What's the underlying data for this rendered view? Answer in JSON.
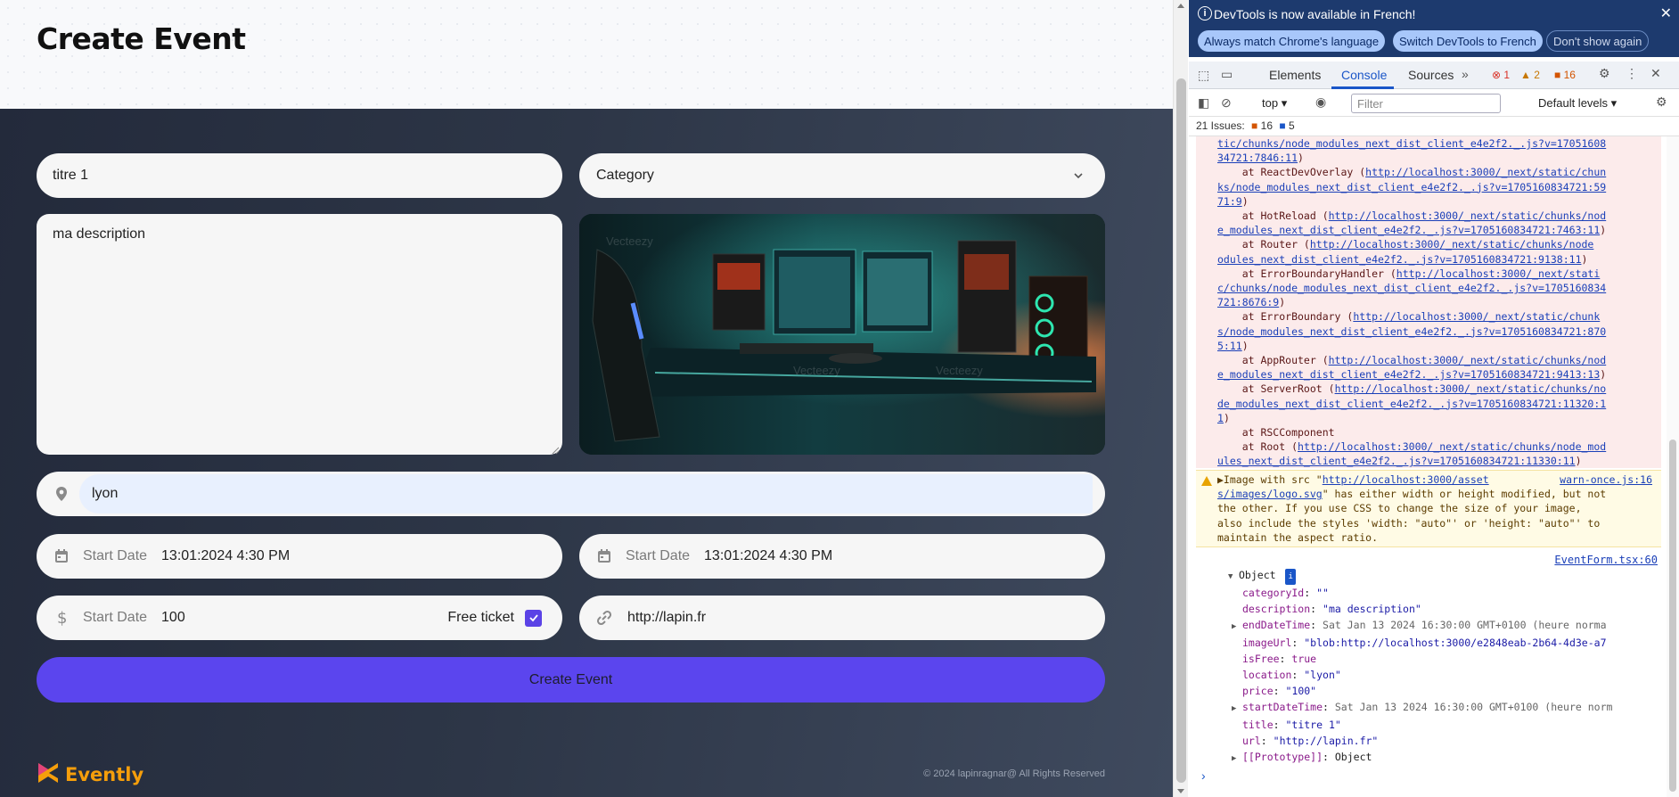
{
  "page": {
    "title": "Create Event"
  },
  "form": {
    "title_value": "titre 1",
    "category_placeholder": "Category",
    "description_value": "ma description",
    "location_value": "lyon",
    "start_date_1": {
      "label": "Start Date",
      "value": "13:01:2024 4:30 PM"
    },
    "start_date_2": {
      "label": "Start Date",
      "value": "13:01:2024 4:30 PM"
    },
    "price": {
      "label": "Start Date",
      "value": "100"
    },
    "free_ticket_label": "Free ticket",
    "free_ticket_checked": true,
    "url_value": "http://lapin.fr",
    "submit_label": "Create Event"
  },
  "footer": {
    "brand": "Evently",
    "copyright": "© 2024 lapinragnar@ All Rights Reserved"
  },
  "colors": {
    "accent": "#5b45ee",
    "brand_orange": "#f59e0b",
    "form_bg": "#2d3647"
  },
  "icons": {
    "location": "map-pin-icon",
    "calendar": "calendar-icon",
    "dollar": "dollar-icon",
    "link": "link-icon",
    "chevron": "chevron-down-icon"
  },
  "devtools": {
    "banner_text": "DevTools is now available in French!",
    "btn_match": "Always match Chrome's language",
    "btn_switch": "Switch DevTools to French",
    "btn_dont": "Don't show again",
    "tabs": [
      "Elements",
      "Console",
      "Sources"
    ],
    "error_count": "1",
    "warning_count": "2",
    "issue_count": "16",
    "context": "top",
    "filter_placeholder": "Filter",
    "levels": "Default levels",
    "issues_label": "21 Issues:",
    "issues_a": "16",
    "issues_b": "5",
    "stack_lines": [
      {
        "pre": "",
        "link": "tic/chunks/node_modules_next_dist_client_e4e2f2._.js?v=17051608",
        "post": ""
      },
      {
        "pre": "",
        "link": "34721:7846:11",
        "post": ")"
      },
      {
        "pre": "    at ReactDevOverlay (",
        "link": "http://localhost:3000/_next/static/chun",
        "post": ""
      },
      {
        "pre": "",
        "link": "ks/node_modules_next_dist_client_e4e2f2._.js?v=1705160834721:59",
        "post": ""
      },
      {
        "pre": "",
        "link": "71:9",
        "post": ")"
      },
      {
        "pre": "    at HotReload (",
        "link": "http://localhost:3000/_next/static/chunks/nod",
        "post": ""
      },
      {
        "pre": "",
        "link": "e_modules_next_dist_client_e4e2f2._.js?v=1705160834721:7463:11",
        "post": ")"
      },
      {
        "pre": "    at Router (",
        "link": "http://localhost:3000/_next/static/chunks/node",
        "post": ""
      },
      {
        "pre": "",
        "link": "odules_next_dist_client_e4e2f2._.js?v=1705160834721:9138:11",
        "post": ")"
      },
      {
        "pre": "    at ErrorBoundaryHandler (",
        "link": "http://localhost:3000/_next/stati",
        "post": ""
      },
      {
        "pre": "",
        "link": "c/chunks/node_modules_next_dist_client_e4e2f2._.js?v=1705160834",
        "post": ""
      },
      {
        "pre": "",
        "link": "721:8676:9",
        "post": ")"
      },
      {
        "pre": "    at ErrorBoundary (",
        "link": "http://localhost:3000/_next/static/chunk",
        "post": ""
      },
      {
        "pre": "",
        "link": "s/node_modules_next_dist_client_e4e2f2._.js?v=1705160834721:870",
        "post": ""
      },
      {
        "pre": "",
        "link": "5:11",
        "post": ")"
      },
      {
        "pre": "    at AppRouter (",
        "link": "http://localhost:3000/_next/static/chunks/nod",
        "post": ""
      },
      {
        "pre": "",
        "link": "e_modules_next_dist_client_e4e2f2._.js?v=1705160834721:9413:13",
        "post": ")"
      },
      {
        "pre": "    at ServerRoot (",
        "link": "http://localhost:3000/_next/static/chunks/no",
        "post": ""
      },
      {
        "pre": "",
        "link": "de_modules_next_dist_client_e4e2f2._.js?v=1705160834721:11320:1",
        "post": ""
      },
      {
        "pre": "",
        "link": "1",
        "post": ")"
      },
      {
        "pre": "    at RSCComponent",
        "link": "",
        "post": ""
      },
      {
        "pre": "    at Root (",
        "link": "http://localhost:3000/_next/static/chunks/node_mod",
        "post": ""
      },
      {
        "pre": "",
        "link": "ules_next_dist_client_e4e2f2._.js?v=1705160834721:11330:11",
        "post": ")"
      }
    ],
    "warning": {
      "line1_pre": "▶Image with src \"",
      "line1_link": "http://localhost:3000/asset",
      "line2_link": "s/images/logo.svg",
      "line2_post": "\" has either width or height modified, but not",
      "line3": "the other. If you use CSS to change the size of your image,",
      "line4": "also include the styles 'width: \"auto\"' or 'height: \"auto\"' to",
      "line5": "maintain the aspect ratio.",
      "source": "warn-once.js:16"
    },
    "log_source": "EventForm.tsx:60",
    "object": {
      "head": "Object",
      "rows": [
        {
          "tri": "",
          "key": "categoryId",
          "val": "\"\"",
          "cls": "s"
        },
        {
          "tri": "",
          "key": "description",
          "val": "\"ma description\"",
          "cls": "s"
        },
        {
          "tri": "▶",
          "key": "endDateTime",
          "val": "Sat Jan 13 2024 16:30:00 GMT+0100 (heure norma",
          "cls": "g"
        },
        {
          "tri": "",
          "key": "imageUrl",
          "val": "\"blob:http://localhost:3000/e2848eab-2b64-4d3e-a7",
          "cls": "s"
        },
        {
          "tri": "",
          "key": "isFree",
          "val": "true",
          "cls": "b"
        },
        {
          "tri": "",
          "key": "location",
          "val": "\"lyon\"",
          "cls": "s"
        },
        {
          "tri": "",
          "key": "price",
          "val": "\"100\"",
          "cls": "s"
        },
        {
          "tri": "▶",
          "key": "startDateTime",
          "val": "Sat Jan 13 2024 16:30:00 GMT+0100 (heure norm",
          "cls": "g"
        },
        {
          "tri": "",
          "key": "title",
          "val": "\"titre 1\"",
          "cls": "s"
        },
        {
          "tri": "",
          "key": "url",
          "val": "\"http://lapin.fr\"",
          "cls": "s"
        },
        {
          "tri": "▶",
          "key": "[[Prototype]]",
          "val": "Object",
          "cls": ""
        }
      ]
    }
  }
}
